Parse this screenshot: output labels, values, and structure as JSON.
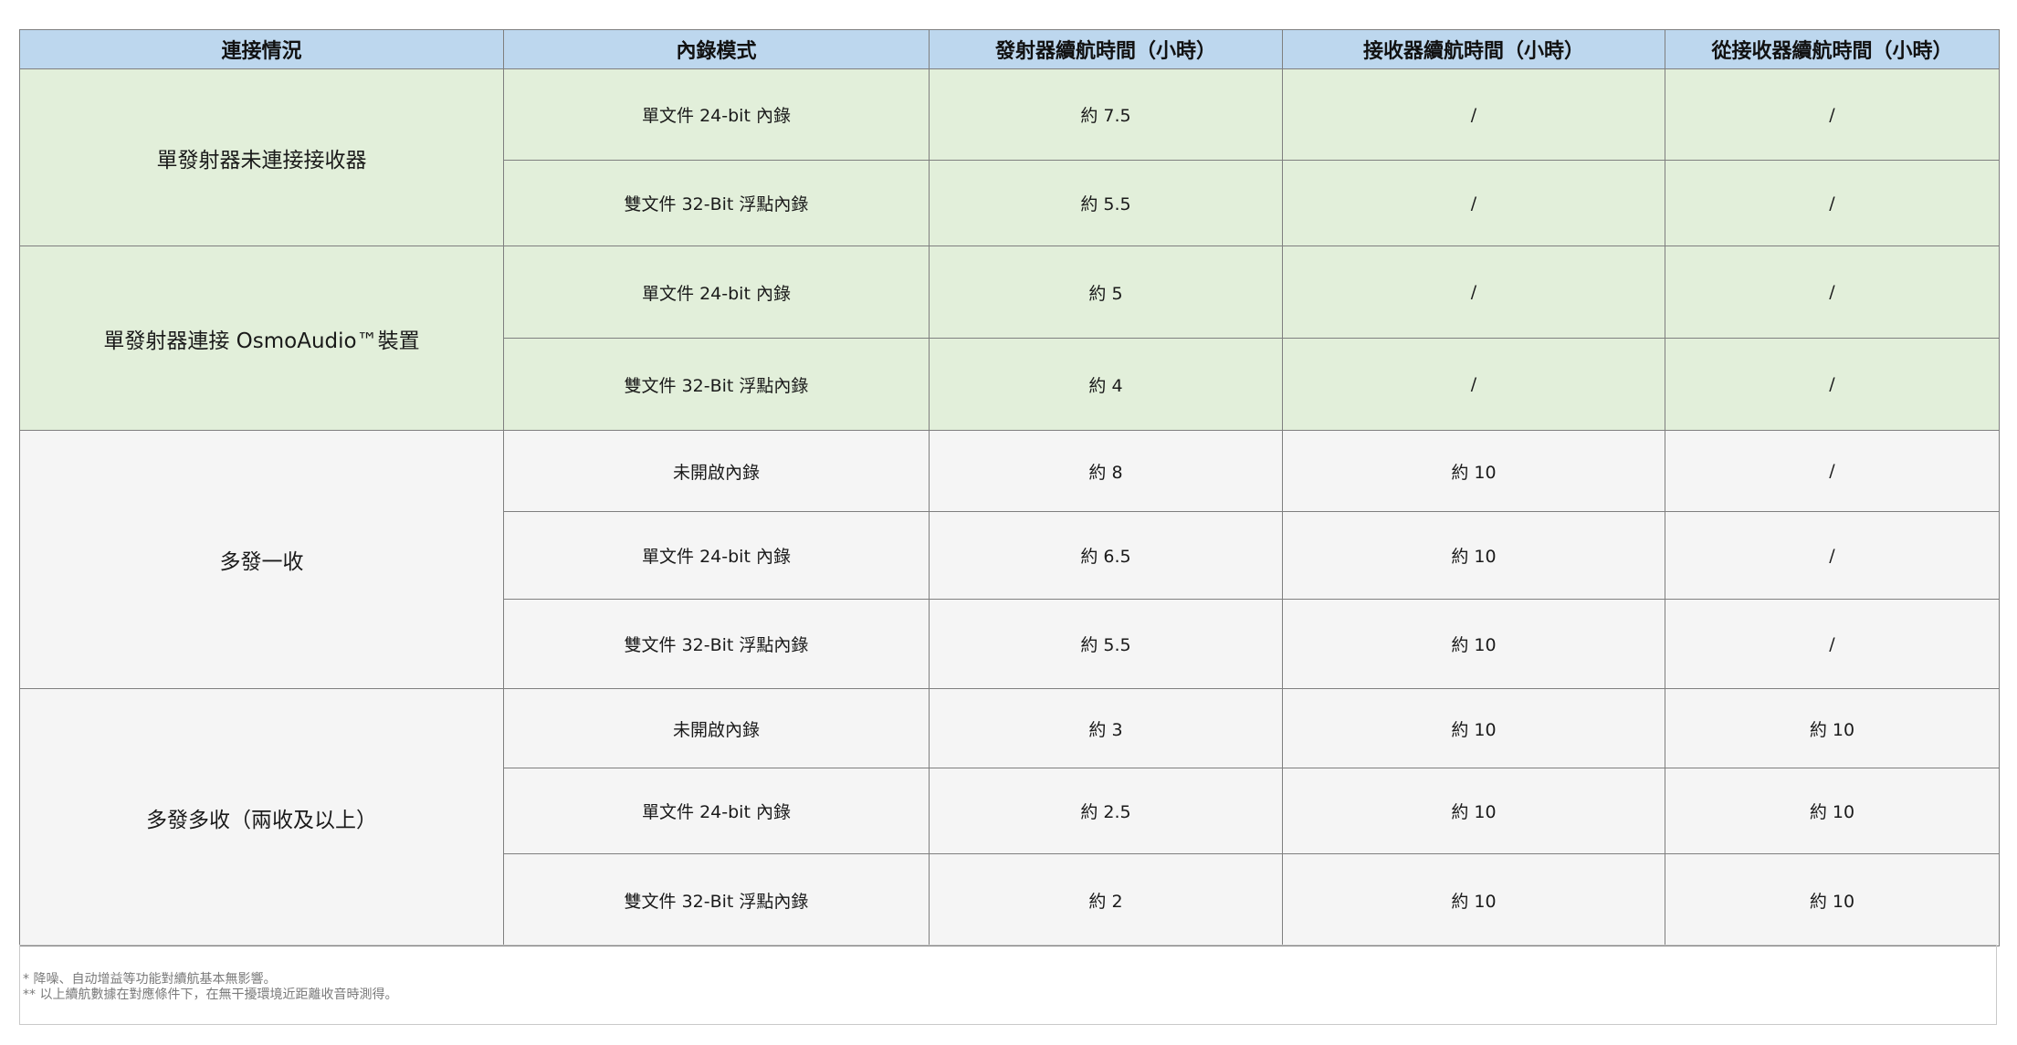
{
  "headers": [
    "連接情況",
    "內錄模式",
    "發射器續航時間（小時）",
    "接收器續航時間（小時）",
    "從接收器續航時間（小時）"
  ],
  "groups": [
    {
      "label": "單發射器未連接接收器",
      "rows": [
        {
          "mode": "單文件 24-bit 內錄",
          "tx": "約 7.5",
          "rx": "/",
          "srx": "/"
        },
        {
          "mode": "雙文件 32-Bit 浮點內錄",
          "tx": "約 5.5",
          "rx": "/",
          "srx": "/"
        }
      ]
    },
    {
      "label": "單發射器連接 OsmoAudio™裝置",
      "rows": [
        {
          "mode": "單文件 24-bit 內錄",
          "tx": "約 5",
          "rx": "/",
          "srx": "/"
        },
        {
          "mode": "雙文件 32-Bit 浮點內錄",
          "tx": "約 4",
          "rx": "/",
          "srx": "/"
        }
      ]
    },
    {
      "label": "多發一收",
      "rows": [
        {
          "mode": "未開啟內錄",
          "tx": "約 8",
          "rx": "約 10",
          "srx": "/"
        },
        {
          "mode": "單文件 24-bit 內錄",
          "tx": "約 6.5",
          "rx": "約 10",
          "srx": "/"
        },
        {
          "mode": "雙文件 32-Bit 浮點內錄",
          "tx": "約 5.5",
          "rx": "約 10",
          "srx": "/"
        }
      ]
    },
    {
      "label": "多發多收（兩收及以上）",
      "rows": [
        {
          "mode": "未開啟內錄",
          "tx": "約 3",
          "rx": "約 10",
          "srx": "約 10"
        },
        {
          "mode": "單文件 24-bit 內錄",
          "tx": "約 2.5",
          "rx": "約 10",
          "srx": "約 10"
        },
        {
          "mode": "雙文件 32-Bit 浮點內錄",
          "tx": "約 2",
          "rx": "約 10",
          "srx": "約 10"
        }
      ]
    }
  ],
  "notes": [
    "* 降噪、自动增益等功能對續航基本無影響。",
    "** 以上續航數據在對應條件下，在無干擾環境近距離收音時測得。"
  ],
  "colors": {
    "header_bg": "#bdd7ee",
    "green_rows_bg": "#e2efda",
    "gray_rows_bg": "#f5f5f5",
    "border": "#7f7f7f"
  }
}
